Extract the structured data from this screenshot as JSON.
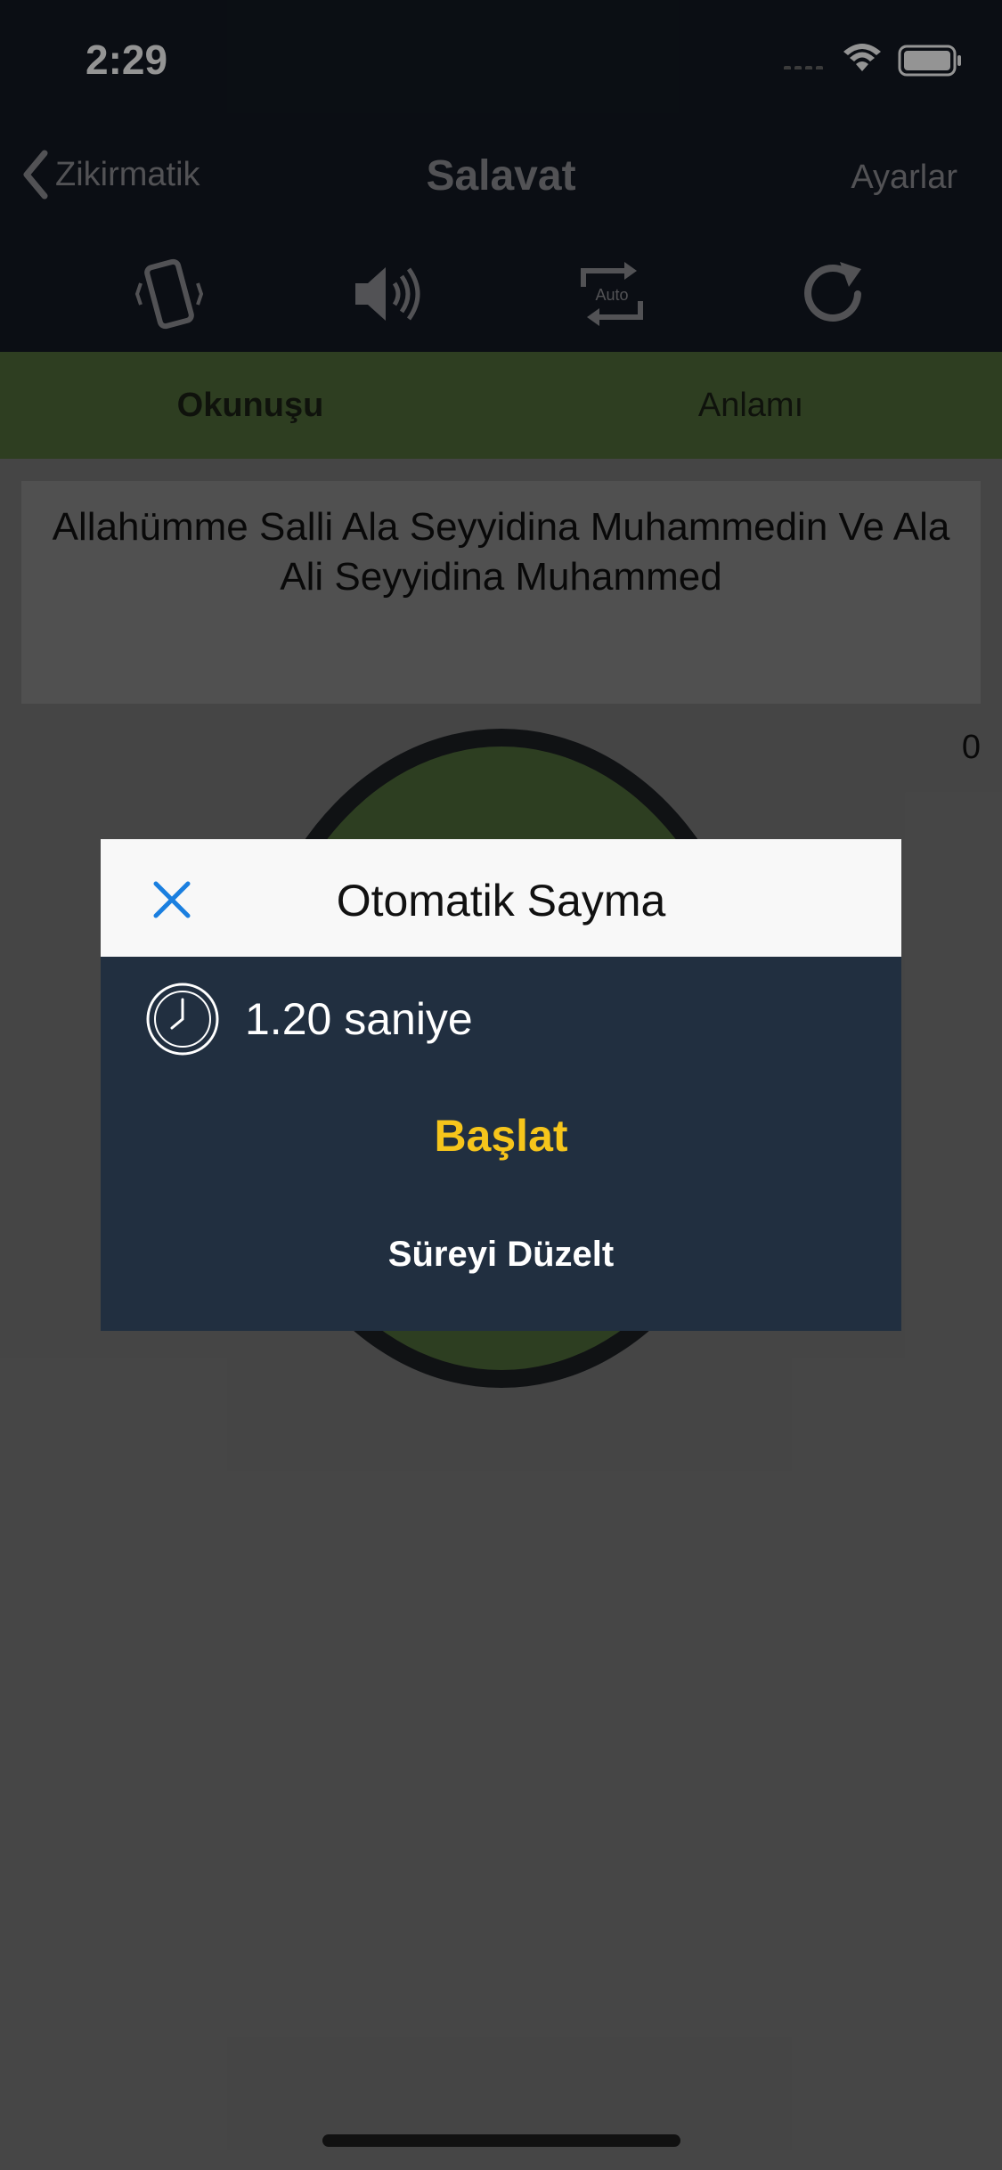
{
  "status_bar": {
    "time": "2:29"
  },
  "nav": {
    "back_label": "Zikirmatik",
    "title": "Salavat",
    "settings_label": "Ayarlar"
  },
  "toolbar": {
    "icons": [
      "vibrate-icon",
      "sound-icon",
      "auto-repeat-icon",
      "reset-icon"
    ],
    "auto_label": "Auto"
  },
  "tabs": [
    {
      "label": "Okunuşu",
      "active": true
    },
    {
      "label": "Anlamı",
      "active": false
    }
  ],
  "dhikr_text": "Allahümme Salli Ala Seyyidina Muhammedin Ve Ala Ali Seyyidina Muhammed",
  "counter": "0",
  "modal": {
    "title": "Otomatik Sayma",
    "interval_label": "1.20 saniye",
    "start_label": "Başlat",
    "edit_label": "Süreyi Düzelt"
  },
  "colors": {
    "accent_green": "#506c3a",
    "modal_bg": "#212f40",
    "start_yellow": "#f6c51b",
    "close_blue": "#1a7fe0"
  }
}
